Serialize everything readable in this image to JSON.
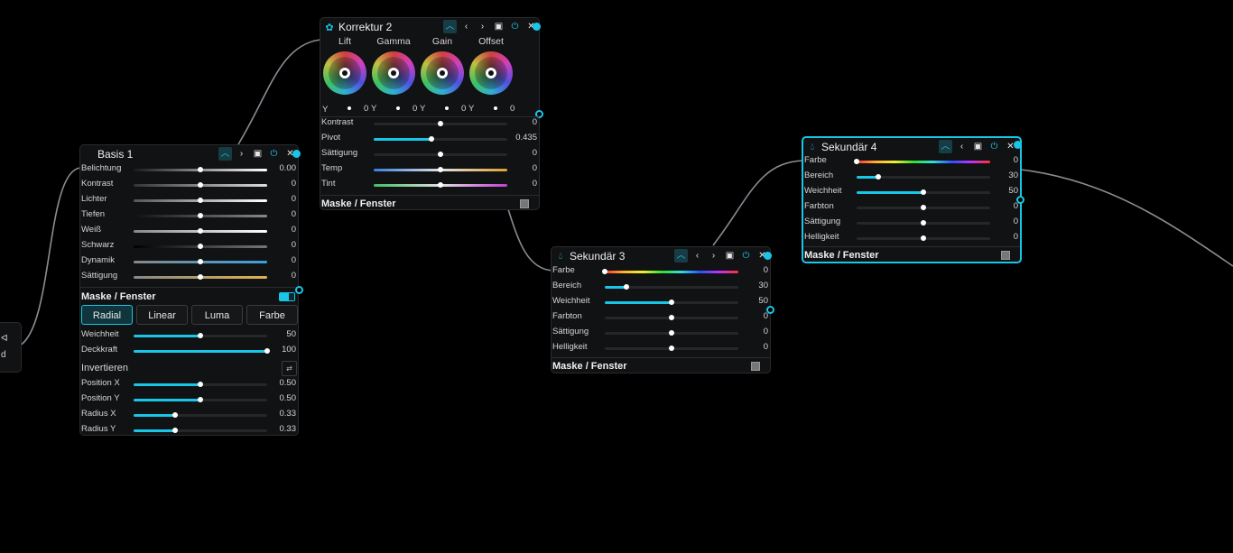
{
  "colors": {
    "accent": "#19c6e6",
    "panel": "#111214",
    "background": "#000000"
  },
  "partial_node": {
    "line1": "ᐊ",
    "line2": "d"
  },
  "basis": {
    "title": "Basis 1",
    "icons": [
      "collapse-icon",
      "next-icon",
      "info-icon",
      "power-icon",
      "close-icon"
    ],
    "sliders": [
      {
        "label": "Belichtung",
        "value": "0.00",
        "pos": 0.5
      },
      {
        "label": "Kontrast",
        "value": "0",
        "pos": 0.5
      },
      {
        "label": "Lichter",
        "value": "0",
        "pos": 0.5
      },
      {
        "label": "Tiefen",
        "value": "0",
        "pos": 0.5
      },
      {
        "label": "Weiß",
        "value": "0",
        "pos": 0.5
      },
      {
        "label": "Schwarz",
        "value": "0",
        "pos": 0.5
      },
      {
        "label": "Dynamik",
        "value": "0",
        "pos": 0.5
      },
      {
        "label": "Sättigung",
        "value": "0",
        "pos": 0.5
      }
    ],
    "mask_label": "Maske / Fenster",
    "mask_enabled": true,
    "mask_types": [
      "Radial",
      "Linear",
      "Luma",
      "Farbe"
    ],
    "mask_active": "Radial",
    "mask_sliders": [
      {
        "label": "Weichheit",
        "value": "50",
        "pos": 0.5
      },
      {
        "label": "Deckkraft",
        "value": "100",
        "pos": 1.0
      }
    ],
    "invert_label": "Invertieren",
    "pos_sliders": [
      {
        "label": "Position X",
        "value": "0.50",
        "pos": 0.5
      },
      {
        "label": "Position Y",
        "value": "0.50",
        "pos": 0.5
      },
      {
        "label": "Radius X",
        "value": "0.33",
        "pos": 0.31
      },
      {
        "label": "Radius Y",
        "value": "0.33",
        "pos": 0.31
      }
    ]
  },
  "korrektur": {
    "title": "Korrektur 2",
    "wheels": [
      {
        "label": "Lift",
        "y_label": "Y",
        "value": "0"
      },
      {
        "label": "Gamma",
        "y_label": "Y",
        "value": "0"
      },
      {
        "label": "Gain",
        "y_label": "Y",
        "value": "0"
      },
      {
        "label": "Offset",
        "y_label": "",
        "value": "0"
      }
    ],
    "leading_y": "Y",
    "sliders": [
      {
        "label": "Kontrast",
        "value": "0",
        "pos": 0.5
      },
      {
        "label": "Pivot",
        "value": "0.435",
        "pos": 0.435
      },
      {
        "label": "Sättigung",
        "value": "0",
        "pos": 0.5
      },
      {
        "label": "Temp",
        "value": "0",
        "pos": 0.5
      },
      {
        "label": "Tint",
        "value": "0",
        "pos": 0.5
      }
    ],
    "mask_label": "Maske / Fenster"
  },
  "sek3": {
    "title": "Sekundär 3",
    "sliders": [
      {
        "label": "Farbe",
        "value": "0",
        "pos": 0.0
      },
      {
        "label": "Bereich",
        "value": "30",
        "pos": 0.16
      },
      {
        "label": "Weichheit",
        "value": "50",
        "pos": 0.5
      },
      {
        "label": "Farbton",
        "value": "0",
        "pos": 0.5
      },
      {
        "label": "Sättigung",
        "value": "0",
        "pos": 0.5
      },
      {
        "label": "Helligkeit",
        "value": "0",
        "pos": 0.5
      }
    ],
    "mask_label": "Maske / Fenster"
  },
  "sek4": {
    "title": "Sekundär 4",
    "sliders": [
      {
        "label": "Farbe",
        "value": "0",
        "pos": 0.0
      },
      {
        "label": "Bereich",
        "value": "30",
        "pos": 0.16
      },
      {
        "label": "Weichheit",
        "value": "50",
        "pos": 0.5
      },
      {
        "label": "Farbton",
        "value": "0",
        "pos": 0.5
      },
      {
        "label": "Sättigung",
        "value": "0",
        "pos": 0.5
      },
      {
        "label": "Helligkeit",
        "value": "0",
        "pos": 0.5
      }
    ],
    "mask_label": "Maske / Fenster"
  }
}
